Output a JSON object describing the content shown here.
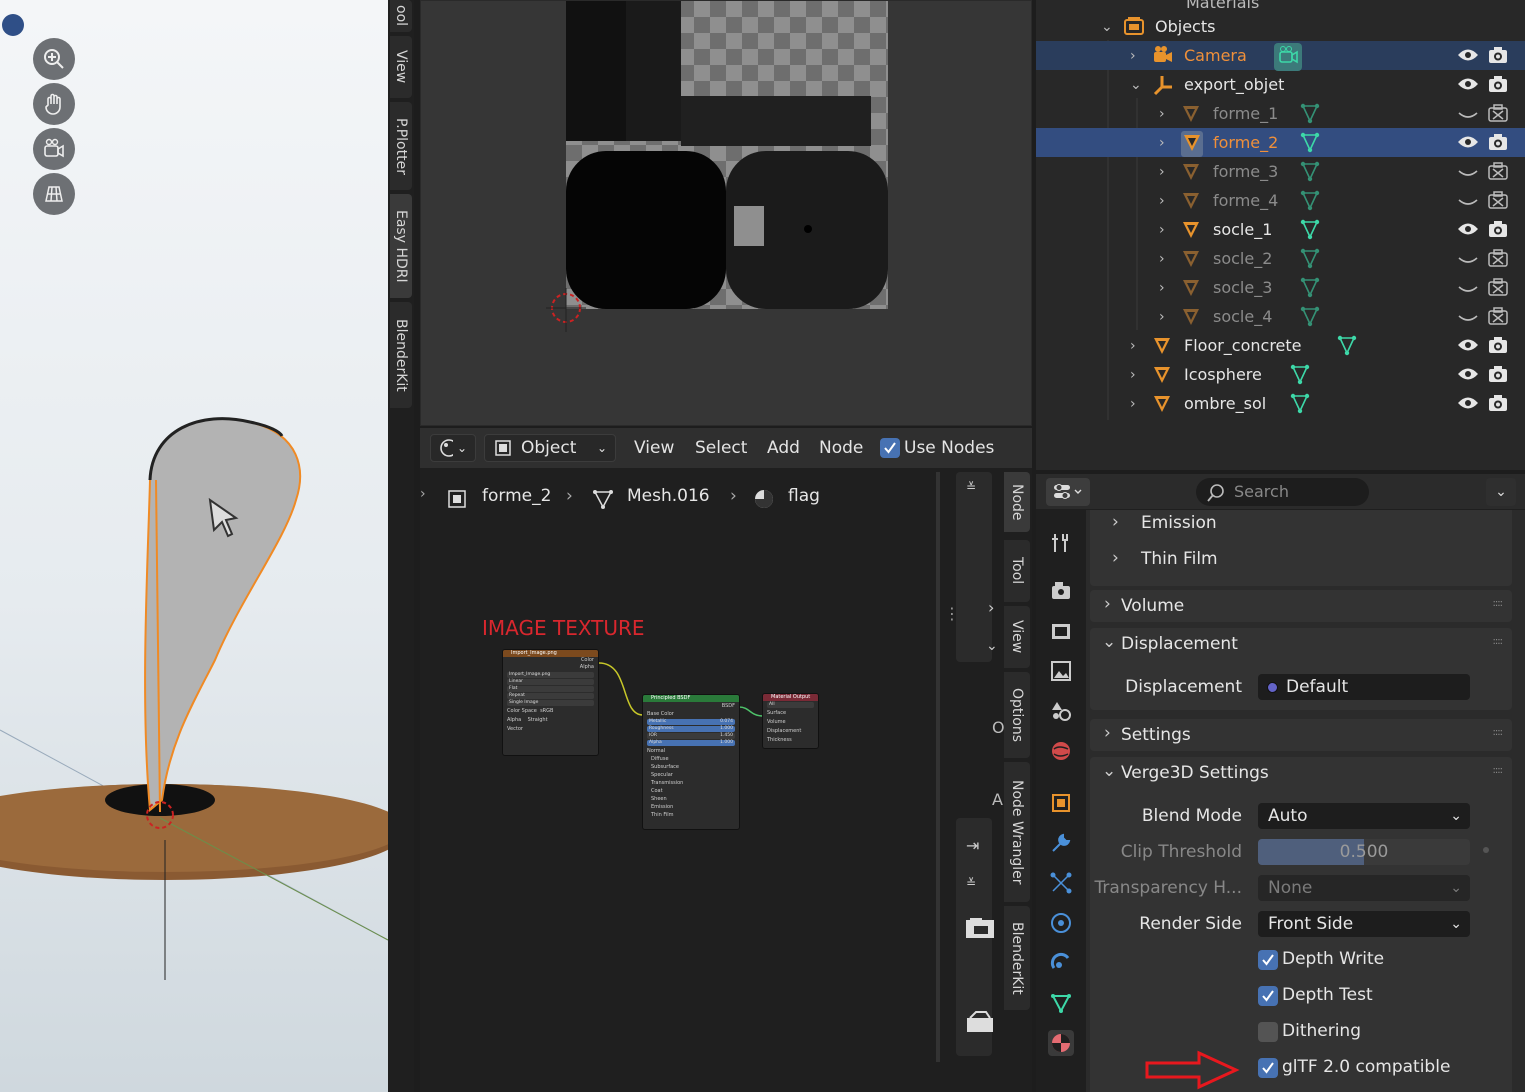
{
  "left_tabs": [
    "ool",
    "View",
    "P.Plotter",
    "Easy HDRI",
    "BlenderKit"
  ],
  "node_header": {
    "mode": "Object",
    "menus": [
      "View",
      "Select",
      "Add",
      "Node"
    ],
    "use_nodes_label": "Use Nodes",
    "use_nodes_checked": true
  },
  "breadcrumb": [
    "forme_2",
    "Mesh.016",
    "flag"
  ],
  "annotation": "IMAGE TEXTURE",
  "nodes": {
    "image": {
      "title": "Import_Image.png",
      "outputs": [
        "Color",
        "Alpha"
      ],
      "file": "Import_Image.png",
      "fields": [
        "Linear",
        "Flat",
        "Repeat",
        "Single Image"
      ],
      "color_space_label": "Color Space",
      "color_space": "sRGB",
      "alpha_label": "Alpha",
      "alpha": "Straight",
      "vector": "Vector"
    },
    "bsdf": {
      "title": "Principled BSDF",
      "output": "BSDF",
      "base_color": "Base Color",
      "fields": [
        {
          "label": "Metallic",
          "value": "0.074"
        },
        {
          "label": "Roughness",
          "value": "1.000"
        },
        {
          "label": "IOR",
          "value": "1.450"
        },
        {
          "label": "Alpha",
          "value": "1.000"
        }
      ],
      "normal": "Normal",
      "subpanels": [
        "Diffuse",
        "Subsurface",
        "Specular",
        "Transmission",
        "Coat",
        "Sheen",
        "Emission",
        "Thin Film"
      ]
    },
    "output": {
      "title": "Material Output",
      "target": "All",
      "inputs": [
        "Surface",
        "Volume",
        "Displacement",
        "Thickness"
      ]
    }
  },
  "node_side_tabs": [
    "Node",
    "Tool",
    "View",
    "Options",
    "Node Wrangler",
    "BlenderKit"
  ],
  "node_side_letters": [
    "O",
    "A"
  ],
  "outliner": {
    "top_partial": "Materials",
    "rows": [
      {
        "label": "Objects",
        "type": "collection",
        "indent": 0
      },
      {
        "label": "Camera",
        "type": "camera",
        "indent": 1,
        "selected": true,
        "active_color": true
      },
      {
        "label": "export_objet",
        "type": "empty",
        "indent": 1
      },
      {
        "label": "forme_1",
        "type": "mesh",
        "indent": 2,
        "ghost": true
      },
      {
        "label": "forme_2",
        "type": "mesh",
        "indent": 2,
        "selected": true,
        "active_color": true
      },
      {
        "label": "forme_3",
        "type": "mesh",
        "indent": 2,
        "ghost": true
      },
      {
        "label": "forme_4",
        "type": "mesh",
        "indent": 2,
        "ghost": true
      },
      {
        "label": "socle_1",
        "type": "mesh",
        "indent": 2
      },
      {
        "label": "socle_2",
        "type": "mesh",
        "indent": 2,
        "ghost": true
      },
      {
        "label": "socle_3",
        "type": "mesh",
        "indent": 2,
        "ghost": true
      },
      {
        "label": "socle_4",
        "type": "mesh",
        "indent": 2,
        "ghost": true
      },
      {
        "label": "Floor_concrete",
        "type": "mesh",
        "indent": 1
      },
      {
        "label": "Icosphere",
        "type": "mesh",
        "indent": 1
      },
      {
        "label": "ombre_sol",
        "type": "mesh",
        "indent": 1
      }
    ]
  },
  "properties": {
    "search_placeholder": "Search",
    "subsections": [
      "Emission",
      "Thin Film"
    ],
    "volume": "Volume",
    "displacement_panel": "Displacement",
    "displacement_label": "Displacement",
    "displacement_value": "Default",
    "settings": "Settings",
    "verge": {
      "title": "Verge3D Settings",
      "blend_mode_label": "Blend Mode",
      "blend_mode": "Auto",
      "clip_label": "Clip Threshold",
      "clip_value": "0.500",
      "clip_fraction": 0.5,
      "transp_label": "Transparency H...",
      "transp_value": "None",
      "render_side_label": "Render Side",
      "render_side": "Front Side",
      "checks": [
        {
          "label": "Depth Write",
          "checked": true
        },
        {
          "label": "Depth Test",
          "checked": true
        },
        {
          "label": "Dithering",
          "checked": false
        },
        {
          "label": "glTF 2.0 compatible",
          "checked": true
        }
      ]
    }
  },
  "colors": {
    "accent": "#4772b3",
    "selected_row": "#334d80",
    "active_text": "#f0903a",
    "mesh_icon": "#e8932c",
    "data_icon": "#3dd8a8",
    "arrow": "#e8181e"
  }
}
